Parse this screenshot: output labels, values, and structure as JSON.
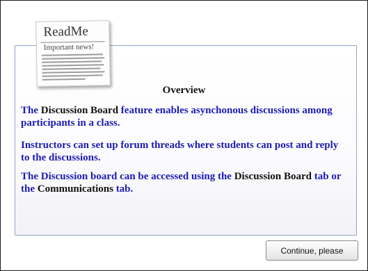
{
  "readme_card": {
    "title": "ReadMe",
    "subtitle": "Important news!"
  },
  "content": {
    "heading": "Overview",
    "paragraphs": [
      {
        "parts": [
          "The ",
          "Discussion Board",
          " feature enables asynchonous discussions among participants in a class."
        ]
      },
      {
        "text": "Instructors can set up forum threads where students can post and reply to the discussions."
      },
      {
        "parts": [
          "The Discussion board can be accessed  using the ",
          "Discussion Board",
          " tab or the ",
          "Communications",
          " tab."
        ]
      }
    ]
  },
  "footer": {
    "continue_label": "Continue, please"
  },
  "colors": {
    "body_text": "#1b1bb5",
    "highlight_text": "#111111",
    "panel_border": "#8fa6c4"
  }
}
